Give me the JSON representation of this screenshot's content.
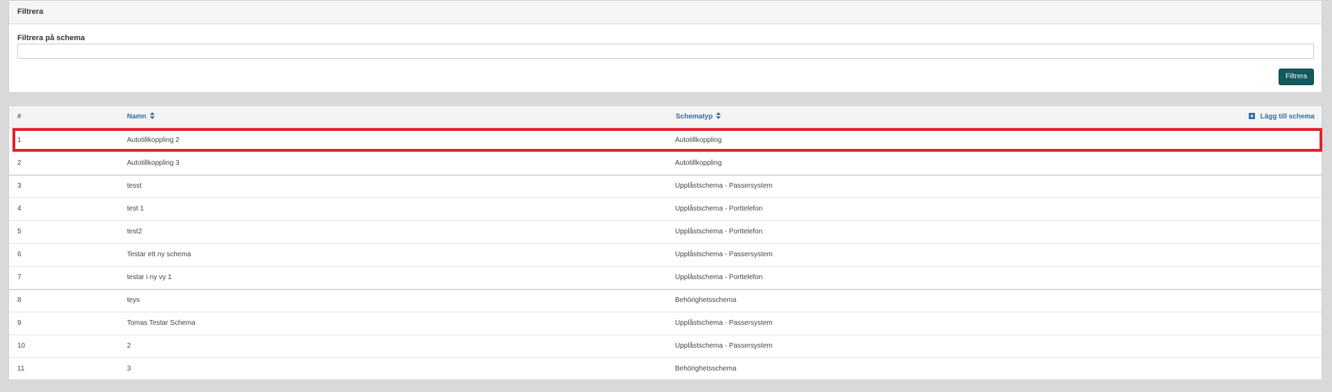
{
  "filter": {
    "title": "Filtrera",
    "label": "Filtrera på schema",
    "input_value": "",
    "input_placeholder": "",
    "button_label": "Filtrera"
  },
  "table": {
    "columns": {
      "num": "#",
      "name": "Namn",
      "type": "Schematyp"
    },
    "add_label": "Lägg till schema",
    "rows": [
      {
        "num": "1",
        "name": "Autotillkoppling 2",
        "type": "Autotillkoppling"
      },
      {
        "num": "2",
        "name": "Autotillkoppling 3",
        "type": "Autotillkoppling"
      },
      {
        "num": "3",
        "name": "tesst",
        "type": "Upplåstschema - Passersystem"
      },
      {
        "num": "4",
        "name": "test 1",
        "type": "Upplåstschema - Porttelefon"
      },
      {
        "num": "5",
        "name": "test2",
        "type": "Upplåstschema - Porttelefon"
      },
      {
        "num": "6",
        "name": "Testar ett ny schema",
        "type": "Upplåstschema - Passersystem"
      },
      {
        "num": "7",
        "name": "testar i ny vy 1",
        "type": "Upplåstschema - Porttelefon"
      },
      {
        "num": "8",
        "name": "teys",
        "type": "Behörighetsschema"
      },
      {
        "num": "9",
        "name": "Tomas Testar Schema",
        "type": "Upplåstschema - Passersystem"
      },
      {
        "num": "10",
        "name": "2",
        "type": "Upplåstschema - Passersystem"
      },
      {
        "num": "11",
        "name": "3",
        "type": "Behörighetsschema"
      }
    ]
  },
  "colors": {
    "accent": "#2e6da4",
    "button": "#12595f",
    "highlight": "#e4202a"
  }
}
